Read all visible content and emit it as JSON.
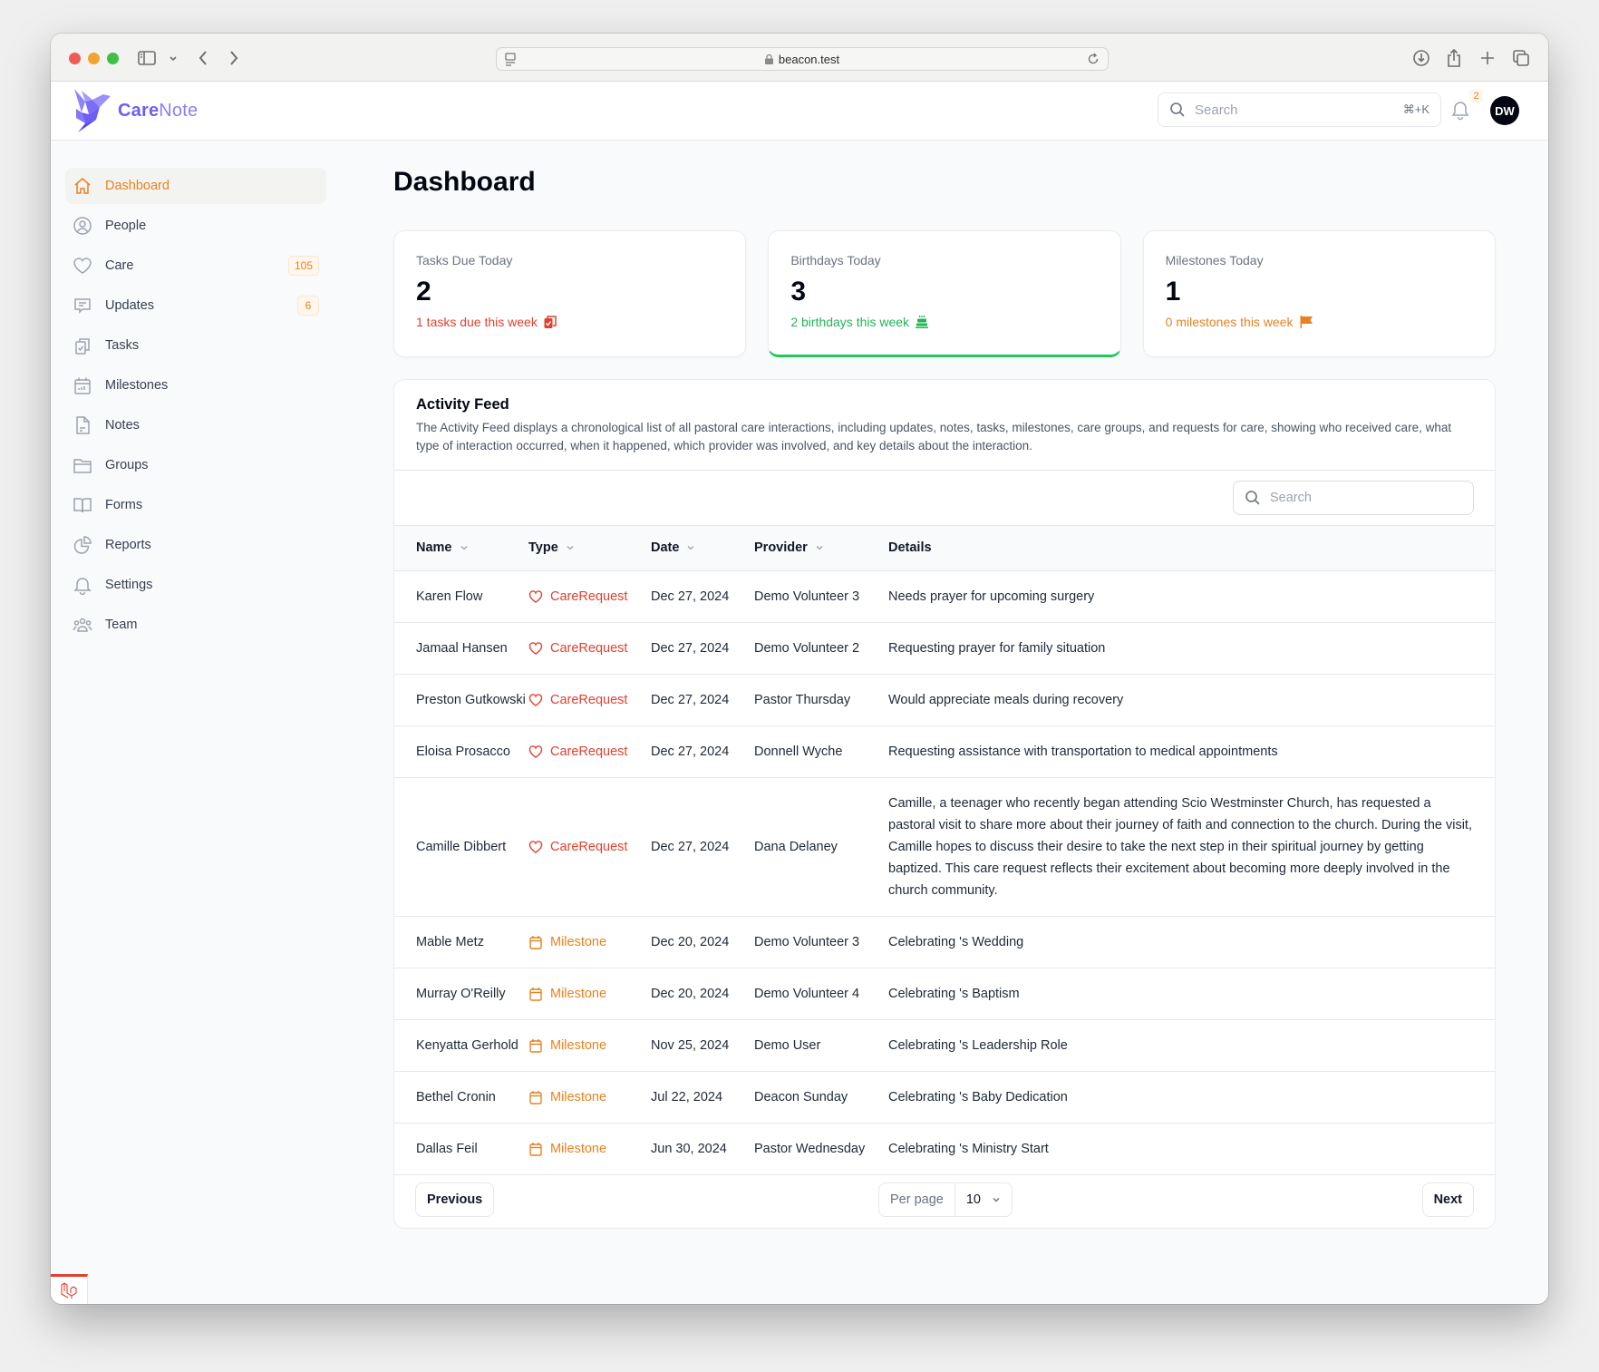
{
  "browser": {
    "url": "beacon.test",
    "icons": [
      "sidebar-toggle-icon",
      "chevron-down-icon",
      "back-icon",
      "forward-icon",
      "reader-icon",
      "lock-icon",
      "reload-icon",
      "download-icon",
      "share-icon",
      "new-tab-icon",
      "tabs-overview-icon"
    ]
  },
  "header": {
    "logo_bold": "Care",
    "logo_light": "Note",
    "search_placeholder": "Search",
    "search_shortcut": "⌘+K",
    "notification_count": "2",
    "avatar_initials": "DW"
  },
  "sidebar": {
    "items": [
      {
        "label": "Dashboard",
        "icon": "home-icon",
        "active": true
      },
      {
        "label": "People",
        "icon": "user-circle-icon"
      },
      {
        "label": "Care",
        "icon": "heart-icon",
        "badge": "105"
      },
      {
        "label": "Updates",
        "icon": "chat-bubble-icon",
        "badge": "6"
      },
      {
        "label": "Tasks",
        "icon": "clipboard-check-icon"
      },
      {
        "label": "Milestones",
        "icon": "calendar-icon"
      },
      {
        "label": "Notes",
        "icon": "document-icon"
      },
      {
        "label": "Groups",
        "icon": "folder-icon"
      },
      {
        "label": "Forms",
        "icon": "book-open-icon"
      },
      {
        "label": "Reports",
        "icon": "chart-pie-icon"
      },
      {
        "label": "Settings",
        "icon": "bell-icon"
      },
      {
        "label": "Team",
        "icon": "user-group-icon"
      }
    ]
  },
  "page": {
    "title": "Dashboard"
  },
  "stats": [
    {
      "label": "Tasks Due Today",
      "value": "2",
      "sub": "1 tasks due this week",
      "icon": "clipboard-icon",
      "color": "#e0412f"
    },
    {
      "label": "Birthdays Today",
      "value": "3",
      "sub": "2 birthdays this week",
      "icon": "cake-icon",
      "color": "#22b356"
    },
    {
      "label": "Milestones Today",
      "value": "1",
      "sub": "0 milestones this week",
      "icon": "flag-icon",
      "color": "#e8821f"
    }
  ],
  "feed": {
    "title": "Activity Feed",
    "description": "The Activity Feed displays a chronological list of all pastoral care interactions, including updates, notes, tasks, milestones, care groups, and requests for care, showing who received care, what type of interaction occurred, when it happened, which provider was involved, and key details about the interaction.",
    "search_placeholder": "Search",
    "columns": [
      "Name",
      "Type",
      "Date",
      "Provider",
      "Details"
    ],
    "rows": [
      {
        "name": "Karen Flow",
        "type": "CareRequest",
        "date": "Dec 27, 2024",
        "provider": "Demo Volunteer 3",
        "details": "Needs prayer for upcoming surgery"
      },
      {
        "name": "Jamaal Hansen",
        "type": "CareRequest",
        "date": "Dec 27, 2024",
        "provider": "Demo Volunteer 2",
        "details": "Requesting prayer for family situation"
      },
      {
        "name": "Preston Gutkowski",
        "type": "CareRequest",
        "date": "Dec 27, 2024",
        "provider": "Pastor Thursday",
        "details": "Would appreciate meals during recovery"
      },
      {
        "name": "Eloisa Prosacco",
        "type": "CareRequest",
        "date": "Dec 27, 2024",
        "provider": "Donnell Wyche",
        "details": "Requesting assistance with transportation to medical appointments"
      },
      {
        "name": "Camille Dibbert",
        "type": "CareRequest",
        "date": "Dec 27, 2024",
        "provider": "Dana Delaney",
        "details": "Camille, a teenager who recently began attending Scio Westminster Church, has requested a pastoral visit to share more about their journey of faith and connection to the church. During the visit, Camille hopes to discuss their desire to take the next step in their spiritual journey by getting baptized. This care request reflects their excitement about becoming more deeply involved in the church community."
      },
      {
        "name": "Mable Metz",
        "type": "Milestone",
        "date": "Dec 20, 2024",
        "provider": "Demo Volunteer 3",
        "details": "Celebrating 's Wedding"
      },
      {
        "name": "Murray O'Reilly",
        "type": "Milestone",
        "date": "Dec 20, 2024",
        "provider": "Demo Volunteer 4",
        "details": "Celebrating 's Baptism"
      },
      {
        "name": "Kenyatta Gerhold",
        "type": "Milestone",
        "date": "Nov 25, 2024",
        "provider": "Demo User",
        "details": "Celebrating 's Leadership Role"
      },
      {
        "name": "Bethel Cronin",
        "type": "Milestone",
        "date": "Jul 22, 2024",
        "provider": "Deacon Sunday",
        "details": "Celebrating 's Baby Dedication"
      },
      {
        "name": "Dallas Feil",
        "type": "Milestone",
        "date": "Jun 30, 2024",
        "provider": "Pastor Wednesday",
        "details": "Celebrating 's Ministry Start"
      }
    ],
    "pagination": {
      "previous_label": "Previous",
      "next_label": "Next",
      "per_page_label": "Per page",
      "per_page_value": "10"
    }
  },
  "colors": {
    "accent": "#e8821f",
    "brand": "#6d5ef5",
    "care_request": "#e0412f",
    "milestone": "#e8821f",
    "success": "#22c55e"
  }
}
